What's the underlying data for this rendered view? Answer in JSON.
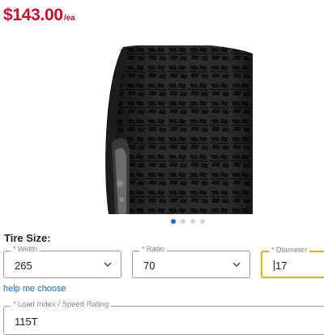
{
  "price": {
    "amount": "$143.00",
    "unit": "/ea"
  },
  "gallery": {
    "total_images": 4,
    "active_index": 0
  },
  "tire_size": {
    "heading": "Tire Size:",
    "required_mark": "*",
    "width": {
      "label": "Width",
      "value": "265"
    },
    "ratio": {
      "label": "Ratio",
      "value": "70"
    },
    "diameter": {
      "label": "Diameter",
      "value": "17"
    },
    "help_link": "help me choose",
    "load_speed": {
      "label": "Load Index / Speed Rating",
      "value": "115T"
    }
  },
  "colors": {
    "price": "#c8102e",
    "link": "#1a6fbd",
    "focus_border": "#e8b400",
    "active_dot": "#1a73c8"
  }
}
